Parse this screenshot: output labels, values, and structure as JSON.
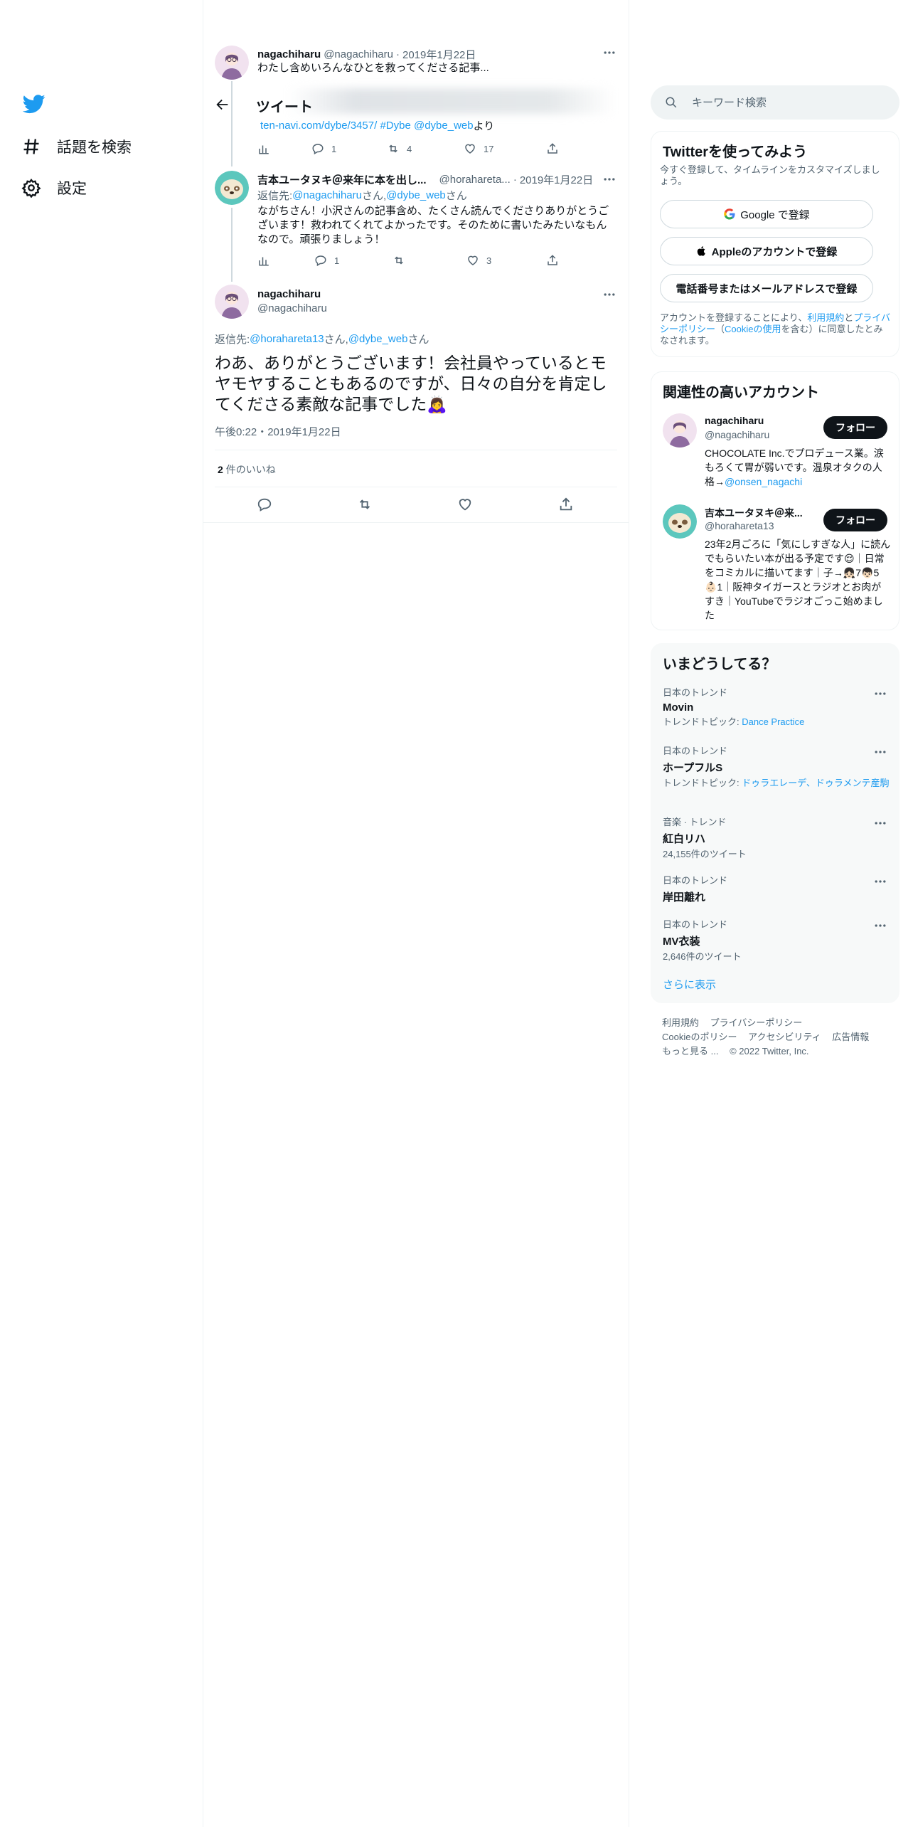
{
  "nav": {
    "items": [
      {
        "label": "話題を検索",
        "icon": "hashtag-icon"
      },
      {
        "label": "設定",
        "icon": "gear-icon"
      }
    ]
  },
  "header": {
    "title": "ツイート"
  },
  "thread": {
    "first": {
      "name": "nagachiharu",
      "handle": "@nagachiharu",
      "dot": "·",
      "date": "2019年1月22日",
      "text": "わたし含めいろんなひとを救ってくださる記事...",
      "link_line": {
        "url": "ten-navi.com/dybe/3457/",
        "hashtag": "#Dybe",
        "mention": "@dybe_web",
        "suffix": "より"
      },
      "stats": {
        "replies": "1",
        "retweets": "4",
        "likes": "17"
      }
    },
    "second": {
      "name": "吉本ユータヌキ＠来年に本を出し...",
      "handle": "@horahareta...",
      "dot": "·",
      "date": "2019年1月22日",
      "reply_prefix": "返信先: ",
      "reply_to_1": "@nagachiharu",
      "reply_san_1": "さん, ",
      "reply_to_2": "@dybe_web",
      "reply_san_2": "さん",
      "text": "ながちさん！小沢さんの記事含め、たくさん読んでくださりありがとうございます！救われてくれてよかったです。そのために書いたみたいなもんなので。頑張りましょう！",
      "stats": {
        "replies": "1",
        "retweets": "",
        "likes": "3"
      }
    },
    "main": {
      "name": "nagachiharu",
      "handle": "@nagachiharu",
      "reply_prefix": "返信先: ",
      "reply_to_1": "@horahareta13",
      "reply_san_1": "さん, ",
      "reply_to_2": "@dybe_web",
      "reply_san_2": "さん",
      "text": "わあ、ありがとうございます！会社員やっているとモヤモヤすることもあるのですが、日々の自分を肯定してくださる素敵な記事でした🙇‍♀️",
      "timestamp": "午後0:22・2019年1月22日",
      "likes_count": "2",
      "likes_label": "件のいいね"
    }
  },
  "right": {
    "search_placeholder": "キーワード検索",
    "signup": {
      "title": "Twitterを使ってみよう",
      "subtitle": "今すぐ登録して、タイムラインをカスタマイズしましょう。",
      "google": "Google で登録",
      "apple": "Appleのアカウントで登録",
      "phone": "電話番号またはメールアドレスで登録",
      "terms_1": "アカウントを登録することにより、",
      "terms_link_1": "利用規約",
      "terms_2": "と",
      "terms_link_2": "プライバシーポリシー",
      "terms_3": "（",
      "terms_link_3": "Cookieの使用",
      "terms_4": "を含む）に同意したとみなされます。"
    },
    "related": {
      "title": "関連性の高いアカウント",
      "follow_label": "フォロー",
      "accounts": [
        {
          "name": "nagachiharu",
          "handle": "@nagachiharu",
          "bio": "CHOCOLATE Inc.でプロデュース業。涙もろくて胃が弱いです。温泉オタクの人格→",
          "bio_link": "@onsen_nagachi"
        },
        {
          "name": "吉本ユータヌキ＠来...",
          "handle": "@horahareta13",
          "bio": "23年2月ごろに「気にしすぎな人」に読んでもらいたい本が出る予定です😌｜日常をコミカルに描いてます｜子→👧🏻7👦🏻5👶🏻1｜阪神タイガースとラジオとお肉がすき｜YouTubeでラジオごっこ始めました",
          "bio_link": ""
        }
      ]
    },
    "trends": {
      "title": "いまどうしてる？",
      "items": [
        {
          "category": "日本のトレンド",
          "title": "Movin",
          "meta_prefix": "トレンドトピック: ",
          "meta_link": "Dance Practice"
        },
        {
          "category": "日本のトレンド",
          "title": "ホープフルS",
          "meta_prefix": "トレンドトピック: ",
          "meta_link": "ドゥラエレーデ、ドゥラメンテ産駒"
        },
        {
          "category": "音楽 · トレンド",
          "title": "紅白リハ",
          "meta_prefix": "24,155件のツイート",
          "meta_link": ""
        },
        {
          "category": "日本のトレンド",
          "title": "岸田離れ",
          "meta_prefix": "",
          "meta_link": ""
        },
        {
          "category": "日本のトレンド",
          "title": "MV衣装",
          "meta_prefix": "2,646件のツイート",
          "meta_link": ""
        }
      ],
      "show_more": "さらに表示"
    },
    "footer": {
      "links": [
        "利用規約",
        "プライバシーポリシー",
        "Cookieのポリシー",
        "アクセシビリティ",
        "広告情報",
        "もっと見る ...",
        "© 2022 Twitter, Inc."
      ]
    }
  },
  "colors": {
    "accent": "#1d9bf0",
    "text": "#0f1419",
    "muted": "#536471",
    "border": "#eff3f4"
  }
}
